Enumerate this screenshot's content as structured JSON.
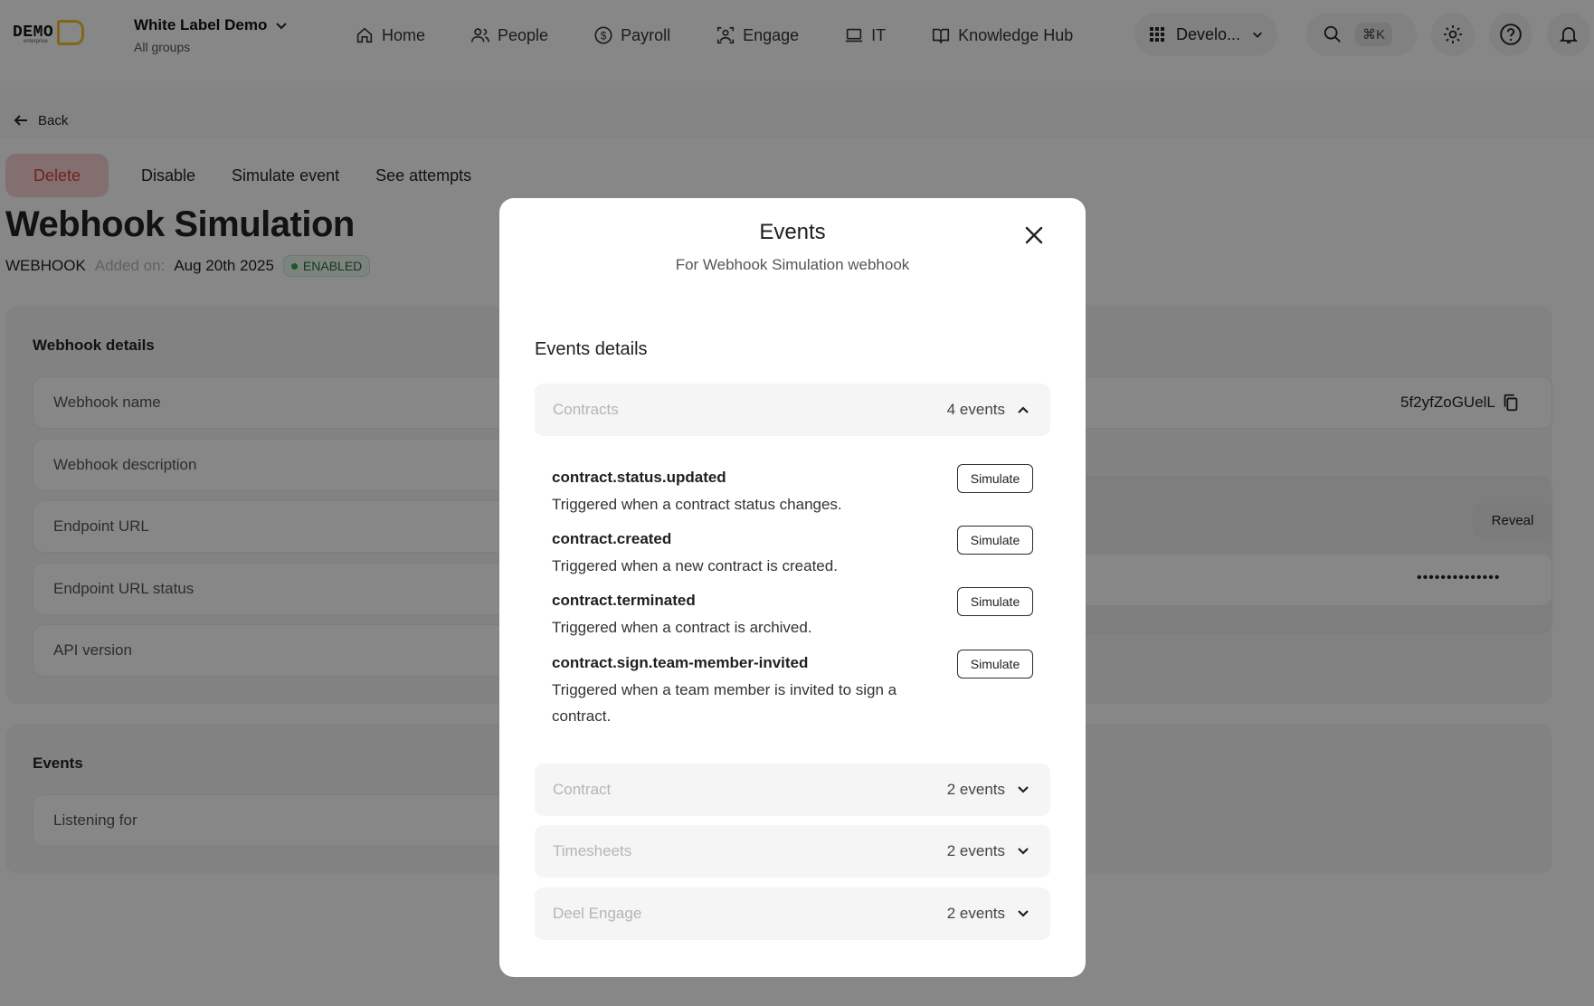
{
  "topbar": {
    "logo_text": "DEMO",
    "logo_sub": "enterprise",
    "org_name": "White Label Demo",
    "org_sub": "All groups",
    "nav": [
      {
        "label": "Home",
        "icon": "home-icon"
      },
      {
        "label": "People",
        "icon": "people-icon"
      },
      {
        "label": "Payroll",
        "icon": "dollar-icon"
      },
      {
        "label": "Engage",
        "icon": "engage-icon"
      },
      {
        "label": "IT",
        "icon": "laptop-icon"
      },
      {
        "label": "Knowledge Hub",
        "icon": "book-icon"
      }
    ],
    "dev_menu": "Develo...",
    "search_shortcut": "⌘K"
  },
  "page": {
    "back_label": "Back",
    "actions": {
      "delete": "Delete",
      "disable": "Disable",
      "simulate": "Simulate event",
      "attempts": "See attempts"
    },
    "title": "Webhook Simulation",
    "type": "WEBHOOK",
    "added_label": "Added on:",
    "added_date": "Aug 20th 2025",
    "status": "ENABLED",
    "details_title": "Webhook details",
    "fields": [
      "Webhook name",
      "Webhook description",
      "Endpoint URL",
      "Endpoint URL status",
      "API version"
    ],
    "webhook_id": "5f2yfZoGUelL",
    "reveal_label": "Reveal",
    "secret_mask": "••••••••••••••",
    "events_title": "Events",
    "listening_label": "Listening for"
  },
  "modal": {
    "title": "Events",
    "subtitle": "For Webhook Simulation webhook",
    "section_label": "Events details",
    "groups": [
      {
        "name": "Contracts",
        "count": "4 events",
        "expanded": true,
        "events": [
          {
            "name": "contract.status.updated",
            "desc": "Triggered when a contract status changes.",
            "button": "Simulate"
          },
          {
            "name": "contract.created",
            "desc": "Triggered when a new contract is created.",
            "button": "Simulate"
          },
          {
            "name": "contract.terminated",
            "desc": "Triggered when a contract is archived.",
            "button": "Simulate"
          },
          {
            "name": "contract.sign.team-member-invited",
            "desc": "Triggered when a team member is invited to sign a contract.",
            "button": "Simulate"
          }
        ]
      },
      {
        "name": "Contract",
        "count": "2 events",
        "expanded": false
      },
      {
        "name": "Timesheets",
        "count": "2 events",
        "expanded": false
      },
      {
        "name": "Deel Engage",
        "count": "2 events",
        "expanded": false
      }
    ]
  },
  "colors": {
    "overlay": "#000000",
    "danger_bg": "#f8d2d2",
    "danger_text": "#d83b3b",
    "enabled_green": "#33a24a",
    "logo_accent": "#f2c12e"
  }
}
